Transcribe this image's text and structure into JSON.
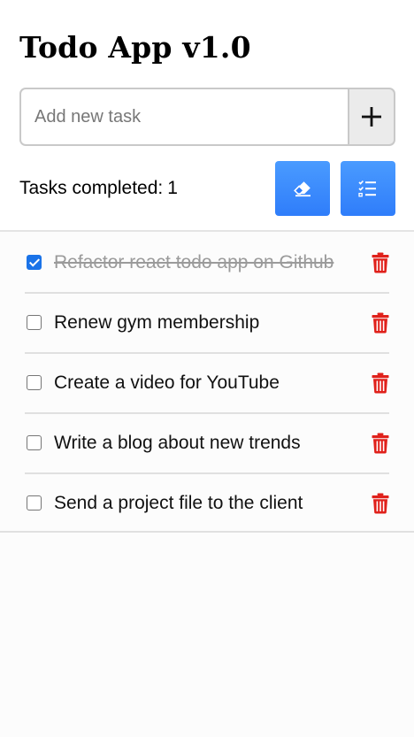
{
  "app": {
    "title": "Todo App v1.0"
  },
  "add": {
    "placeholder": "Add new task",
    "button_icon": "plus-icon"
  },
  "status": {
    "label": "Tasks completed:",
    "count": "1"
  },
  "actions": [
    {
      "name": "clear-completed-button",
      "icon": "eraser-icon"
    },
    {
      "name": "check-all-button",
      "icon": "checklist-icon"
    }
  ],
  "tasks": [
    {
      "text": "Refactor react todo app on Github",
      "completed": true
    },
    {
      "text": "Renew gym membership",
      "completed": false
    },
    {
      "text": "Create a video for YouTube",
      "completed": false
    },
    {
      "text": "Write a blog about new trends",
      "completed": false
    },
    {
      "text": "Send a project file to the client",
      "completed": false
    }
  ],
  "colors": {
    "accent": "#2f7dfa",
    "delete": "#e0201a",
    "checked": "#1a73e8"
  }
}
